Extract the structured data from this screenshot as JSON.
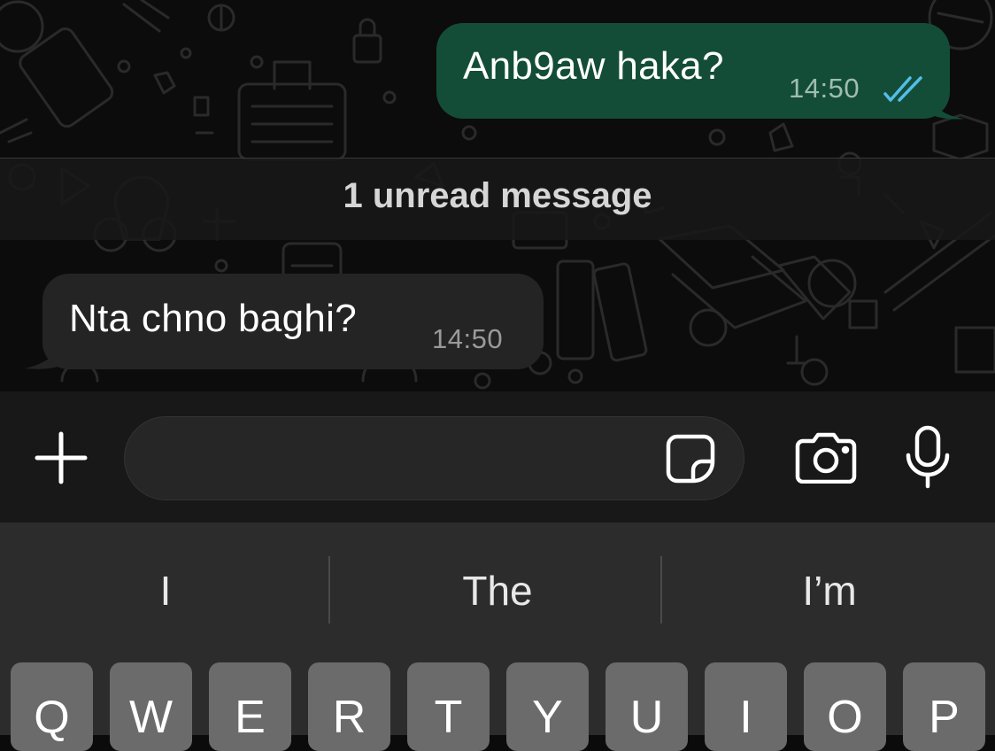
{
  "messages": [
    {
      "direction": "outgoing",
      "text": "Anb9aw haka?",
      "time": "14:50",
      "status": "read"
    },
    {
      "direction": "incoming",
      "text": "Nta chno baghi?",
      "time": "14:50"
    }
  ],
  "unread_banner": "1 unread message",
  "composer": {
    "attach_icon": "plus-icon",
    "sticker_icon": "sticker-icon",
    "camera_icon": "camera-icon",
    "mic_icon": "microphone-icon",
    "placeholder": ""
  },
  "keyboard": {
    "suggestions": [
      "I",
      "The",
      "I’m"
    ],
    "row1": [
      "Q",
      "W",
      "E",
      "R",
      "T",
      "Y",
      "U",
      "I",
      "O",
      "P"
    ]
  },
  "colors": {
    "outgoing_bubble": "#144d37",
    "incoming_bubble": "#242424",
    "read_tick": "#53bdeb",
    "background": "#0c0c0c"
  }
}
